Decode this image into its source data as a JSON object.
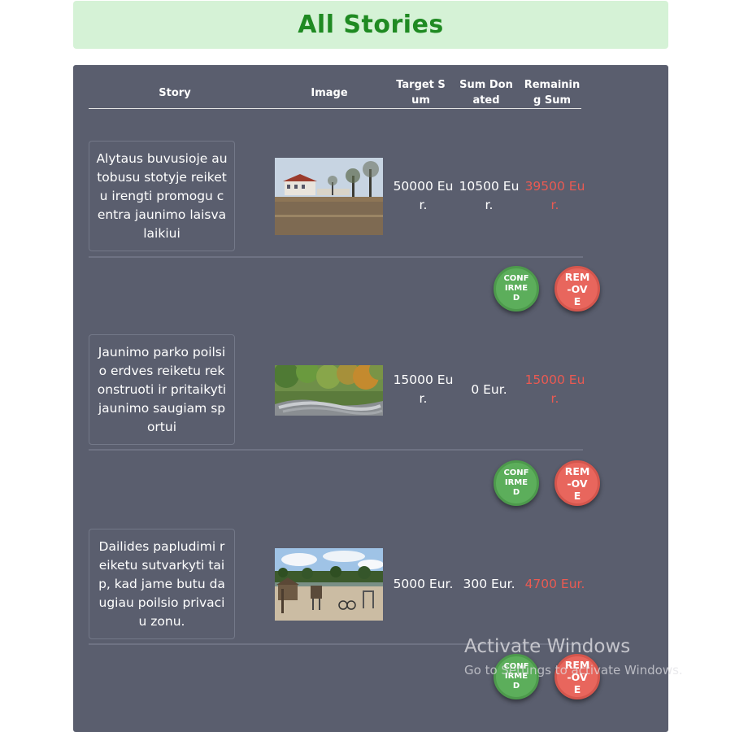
{
  "page": {
    "title": "All Stories"
  },
  "table": {
    "headers": {
      "story": "Story",
      "image": "Image",
      "target": "Target Sum",
      "donated": "Sum Donated",
      "remaining": "Remaining Sum"
    },
    "rows": [
      {
        "story": "Alytaus buvusioje autobusu stotyje reiketu irengti promogu centra jaunimo laisvalaikiui",
        "image": "town-square-photo",
        "target": "50000 Eur.",
        "donated": "10500 Eur.",
        "remaining": "39500 Eur."
      },
      {
        "story": "Jaunimo parko poilsio erdves reiketu rekonstruoti ir pritaikyti jaunimo saugiam sportui",
        "image": "pump-track-park-photo",
        "target": "15000 Eur.",
        "donated": "0 Eur.",
        "remaining": "15000 Eur."
      },
      {
        "story": "Dailides papludimi reiketu sutvarkyti taip, kad jame butu daugiau poilsio privaciu zonu.",
        "image": "beach-playground-photo",
        "target": "5000 Eur.",
        "donated": "300 Eur.",
        "remaining": "4700 Eur."
      }
    ]
  },
  "actions": {
    "confirm_label": "CONFIRMED",
    "remove_label": "REM-OVE"
  },
  "watermark": {
    "title": "Activate Windows",
    "subtitle": "Go to Settings to activate Windows."
  },
  "colors": {
    "header_bg": "#d5f2d6",
    "title": "#1f8a22",
    "panel_bg": "#5a5e6e",
    "remaining": "#ea5a52",
    "confirm": "#5cae5b",
    "remove": "#e8665d"
  }
}
